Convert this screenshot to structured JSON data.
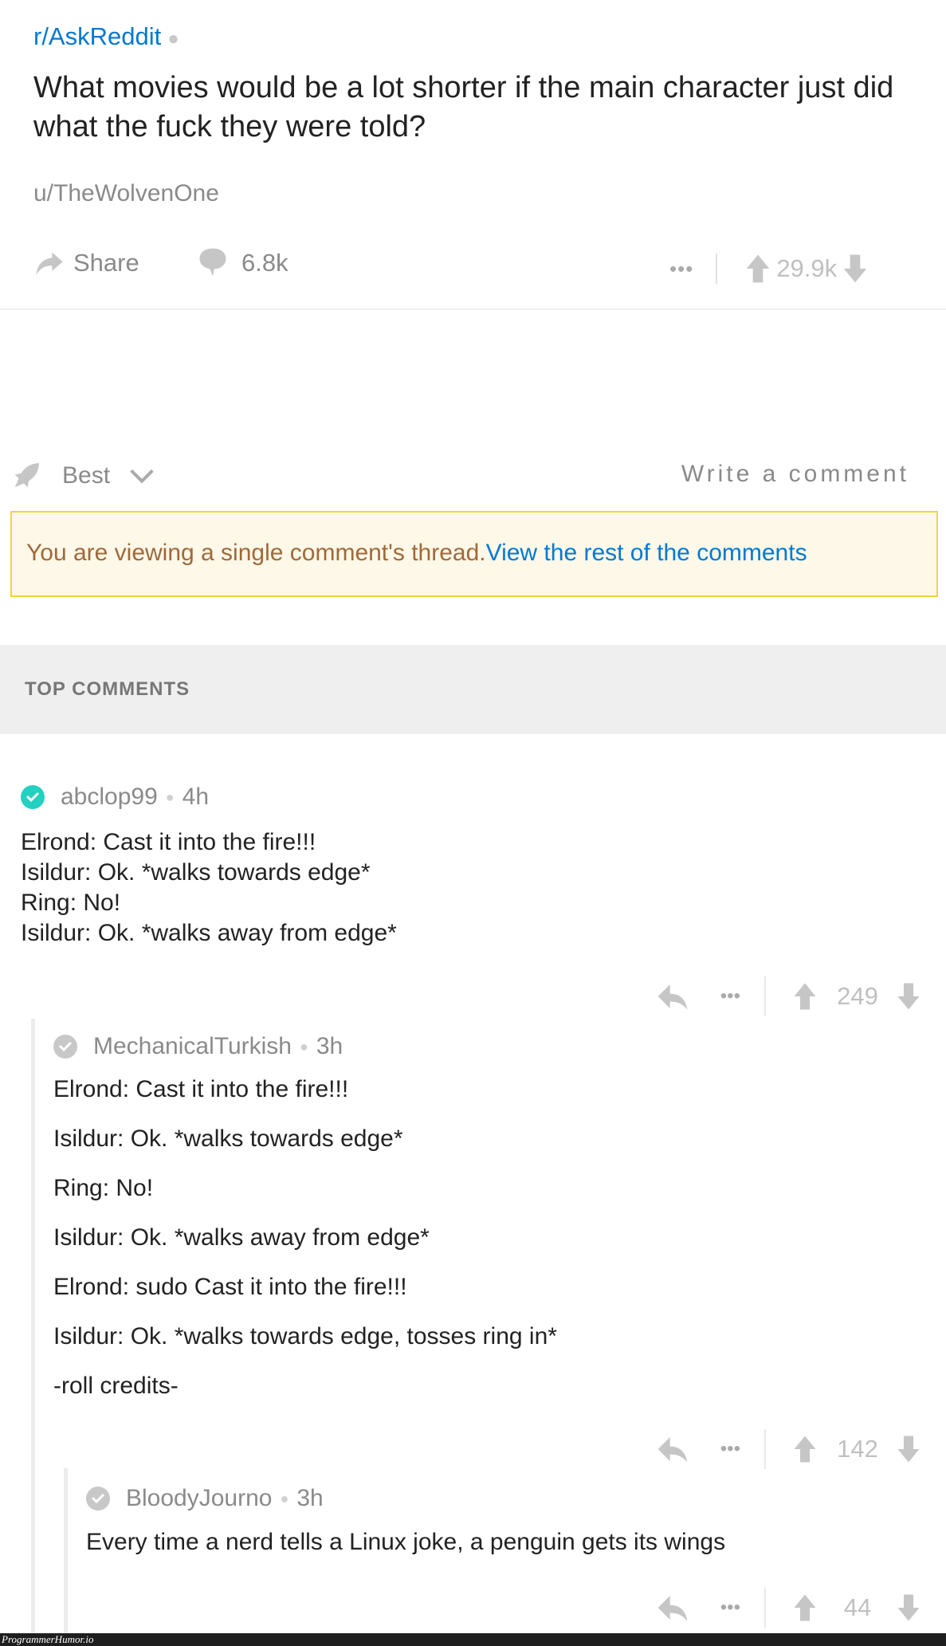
{
  "post": {
    "subreddit": "r/AskReddit",
    "title": "What movies would be a lot shorter if the main character just did what the fuck they were told?",
    "author": "u/TheWolvenOne",
    "share_label": "Share",
    "comments": "6.8k",
    "score": "29.9k"
  },
  "sort": {
    "label": "Best",
    "write_comment": "Write a comment"
  },
  "banner": {
    "text": "You are viewing a single comment's thread.",
    "link": "View the rest of the comments"
  },
  "section_title": "TOP COMMENTS",
  "comments": [
    {
      "user": "abclop99",
      "time": "4h",
      "lines": [
        "Elrond: Cast it into the fire!!!",
        "Isildur: Ok. *walks towards edge*",
        "Ring: No!",
        "Isildur: Ok. *walks away from edge*"
      ],
      "score": "249",
      "avatar_color": "#24d0c0"
    },
    {
      "user": "MechanicalTurkish",
      "time": "3h",
      "lines": [
        "Elrond: Cast it into the fire!!!",
        "Isildur: Ok. *walks towards edge*",
        "Ring: No!",
        "Isildur: Ok. *walks away from edge*",
        "Elrond: sudo Cast it into the fire!!!",
        "Isildur: Ok. *walks towards edge, tosses ring in*",
        "-roll credits-"
      ],
      "score": "142",
      "avatar_color": "#c8c8c8"
    },
    {
      "user": "BloodyJourno",
      "time": "3h",
      "lines": [
        "Every time a nerd tells a Linux joke, a penguin gets its wings"
      ],
      "score": "44",
      "avatar_color": "#c8c8c8"
    }
  ],
  "watermark": "ProgrammerHumor.io"
}
